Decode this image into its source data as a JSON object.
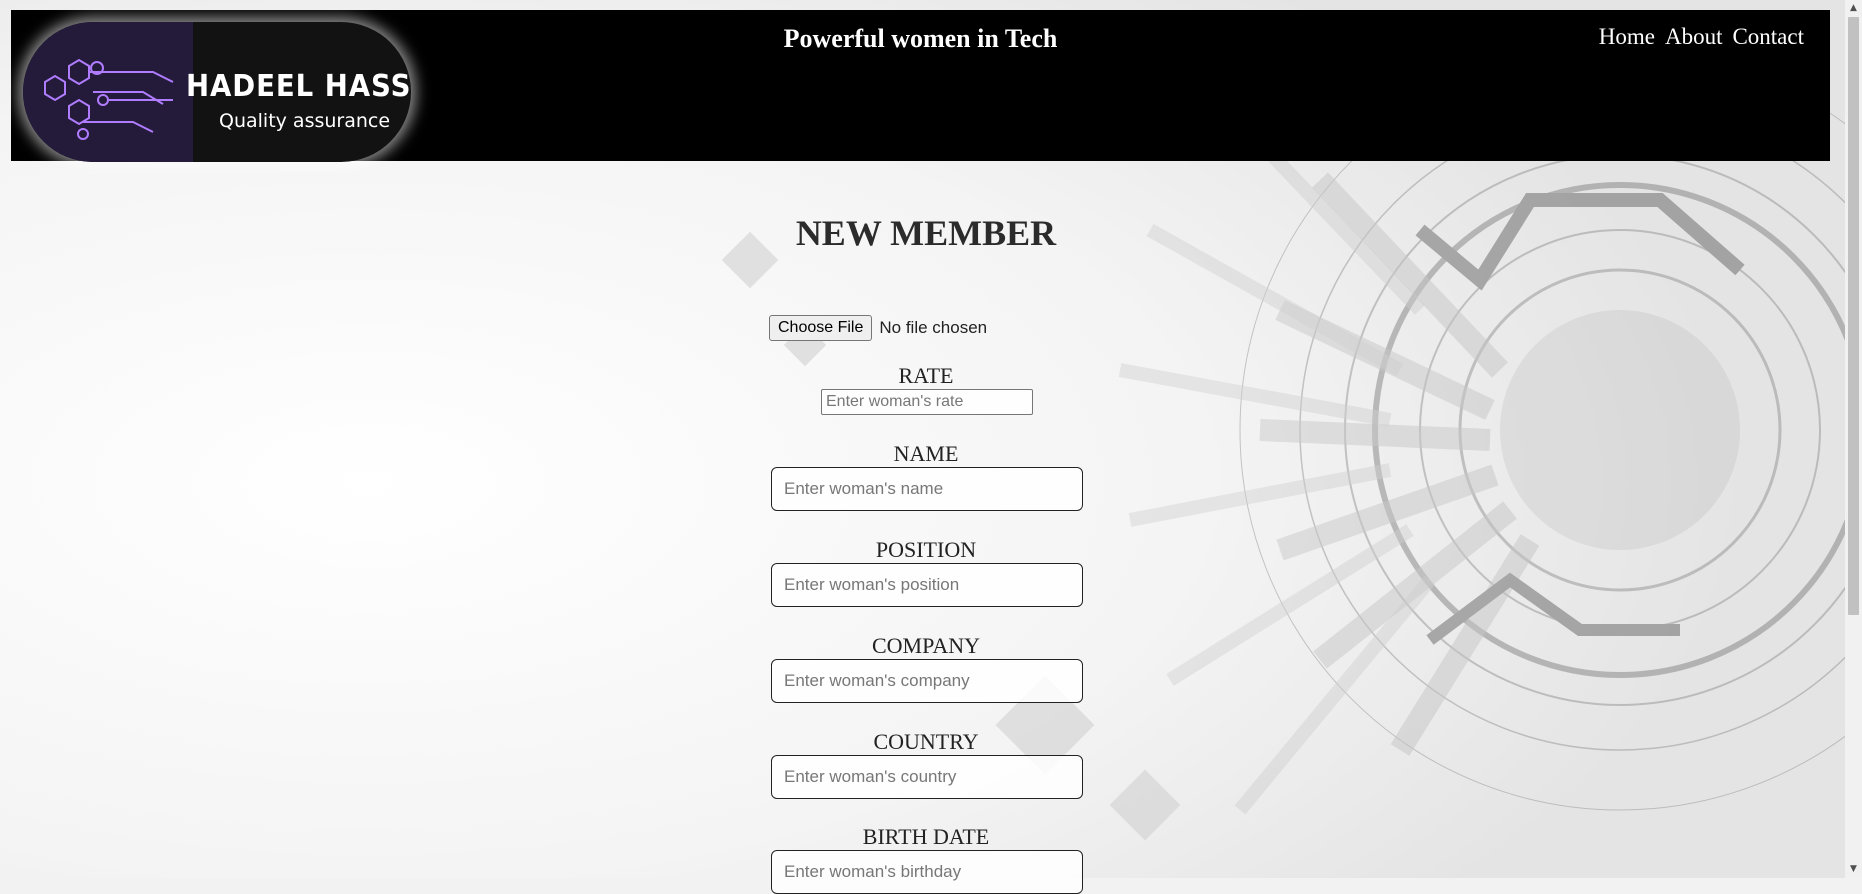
{
  "logo": {
    "name": "HADEEL HASSAN",
    "subtitle": "Quality assurance"
  },
  "header": {
    "title": "Powerful women in Tech"
  },
  "nav": {
    "home": "Home",
    "about": "About",
    "contact": "Contact"
  },
  "form": {
    "title": "NEW MEMBER",
    "file_button": "Choose File",
    "file_status": "No file chosen",
    "rate": {
      "label": "RATE",
      "placeholder": "Enter woman's rate"
    },
    "name": {
      "label": "NAME",
      "placeholder": "Enter woman's name"
    },
    "position": {
      "label": "POSITION",
      "placeholder": "Enter woman's position"
    },
    "company": {
      "label": "COMPANY",
      "placeholder": "Enter woman's company"
    },
    "country": {
      "label": "COUNTRY",
      "placeholder": "Enter woman's country"
    },
    "birth_date": {
      "label": "BIRTH DATE",
      "placeholder": "Enter woman's birthday"
    }
  },
  "scrollbar": {
    "up_icon": "triangle-up-icon",
    "down_icon": "triangle-down-icon"
  }
}
